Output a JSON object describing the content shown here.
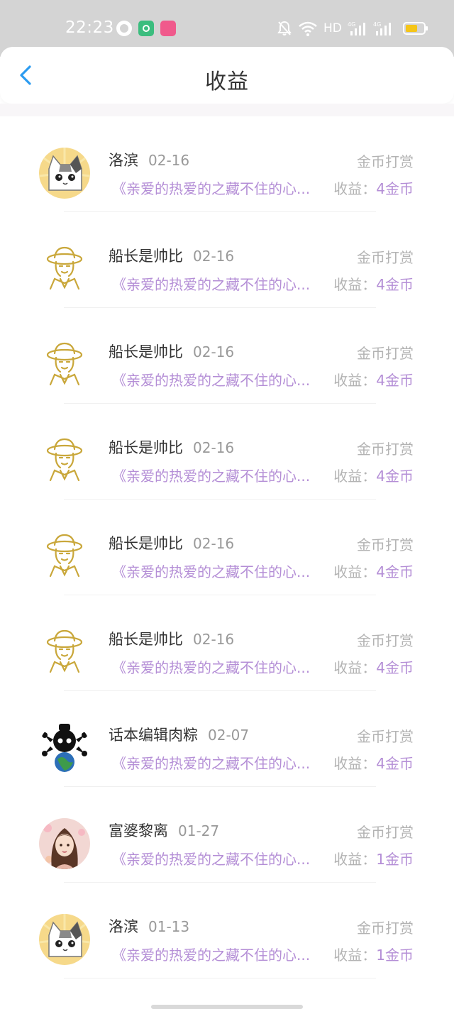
{
  "status_bar": {
    "time": "22:23",
    "network": "HD",
    "signal_1": "4G",
    "signal_2": "4G"
  },
  "header": {
    "title": "收益"
  },
  "colors": {
    "accent_purple": "#b48ed6",
    "back_blue": "#2b9bf0",
    "battery_yellow": "#f5c518"
  },
  "entries": [
    {
      "name": "洛滨",
      "date": "02-16",
      "type": "金币打赏",
      "book": "《亲爱的热爱的之藏不住的心...",
      "earn_label": "收益：",
      "earn_value": "4金币",
      "avatar": "cat-avatar"
    },
    {
      "name": "船长是帅比",
      "date": "02-16",
      "type": "金币打赏",
      "book": "《亲爱的热爱的之藏不住的心...",
      "earn_label": "收益：",
      "earn_value": "4金币",
      "avatar": "straw-hat-avatar"
    },
    {
      "name": "船长是帅比",
      "date": "02-16",
      "type": "金币打赏",
      "book": "《亲爱的热爱的之藏不住的心...",
      "earn_label": "收益：",
      "earn_value": "4金币",
      "avatar": "straw-hat-avatar"
    },
    {
      "name": "船长是帅比",
      "date": "02-16",
      "type": "金币打赏",
      "book": "《亲爱的热爱的之藏不住的心...",
      "earn_label": "收益：",
      "earn_value": "4金币",
      "avatar": "straw-hat-avatar"
    },
    {
      "name": "船长是帅比",
      "date": "02-16",
      "type": "金币打赏",
      "book": "《亲爱的热爱的之藏不住的心...",
      "earn_label": "收益：",
      "earn_value": "4金币",
      "avatar": "straw-hat-avatar"
    },
    {
      "name": "船长是帅比",
      "date": "02-16",
      "type": "金币打赏",
      "book": "《亲爱的热爱的之藏不住的心...",
      "earn_label": "收益：",
      "earn_value": "4金币",
      "avatar": "straw-hat-avatar"
    },
    {
      "name": "话本编辑肉粽",
      "date": "02-07",
      "type": "金币打赏",
      "book": "《亲爱的热爱的之藏不住的心...",
      "earn_label": "收益：",
      "earn_value": "4金币",
      "avatar": "skull-earth-avatar"
    },
    {
      "name": "富婆黎离",
      "date": "01-27",
      "type": "金币打赏",
      "book": "《亲爱的热爱的之藏不住的心...",
      "earn_label": "收益：",
      "earn_value": "1金币",
      "avatar": "girl-portrait-avatar"
    },
    {
      "name": "洛滨",
      "date": "01-13",
      "type": "金币打赏",
      "book": "《亲爱的热爱的之藏不住的心...",
      "earn_label": "收益：",
      "earn_value": "1金币",
      "avatar": "cat-avatar"
    }
  ]
}
